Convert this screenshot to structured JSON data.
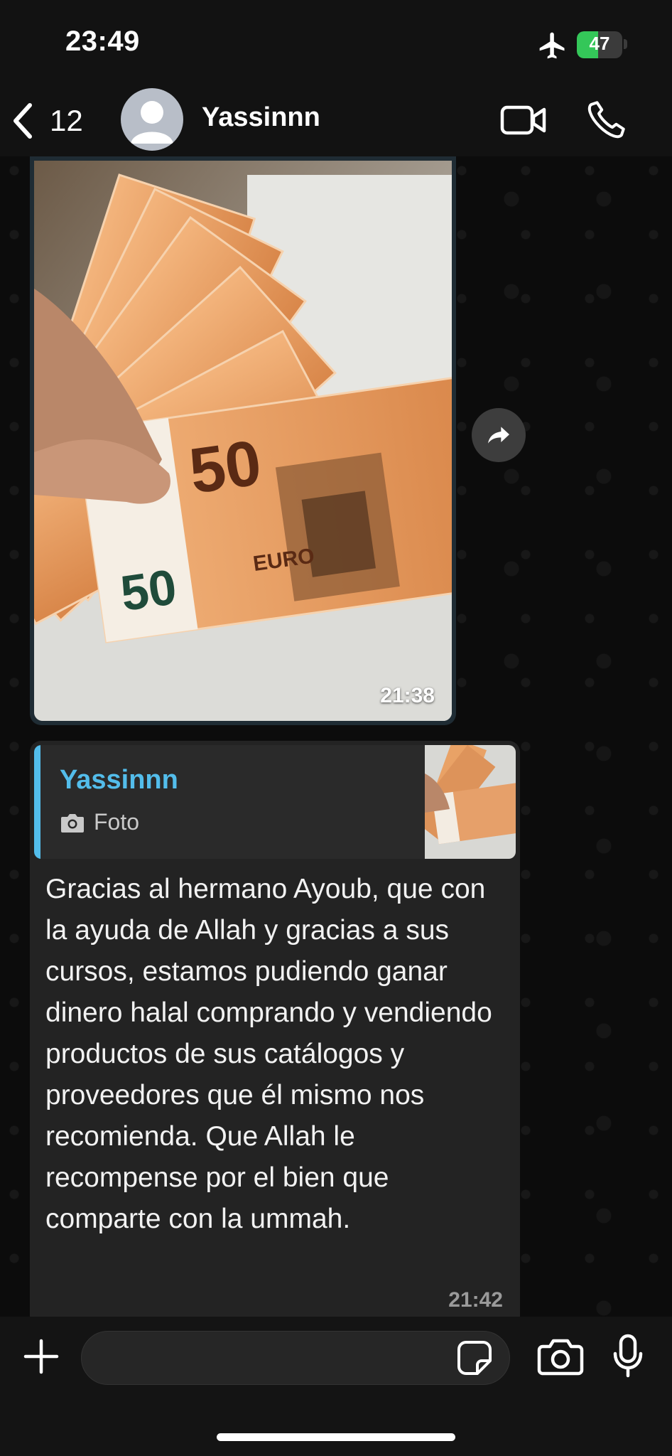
{
  "status_bar": {
    "time": "23:49",
    "battery_percent": "47",
    "battery_level": 0.47,
    "airplane_mode": true,
    "icons": [
      "airplane-icon",
      "battery-icon"
    ]
  },
  "header": {
    "back_count": "12",
    "contact_name": "Yassinnn",
    "icons": [
      "chevron-left-icon",
      "avatar-icon",
      "video-camera-icon",
      "phone-icon"
    ]
  },
  "messages": [
    {
      "type": "image",
      "time": "21:38",
      "image_description_icon": "euro-banknotes-photo"
    },
    {
      "type": "text",
      "quote": {
        "author": "Yassinnn",
        "media_label": "Foto"
      },
      "text": "Gracias al hermano Ayoub, que con la ayuda de Allah y gracias a sus cursos, estamos pudiendo ganar dinero halal comprando y vendiendo productos de sus catálogos y proveedores que él mismo nos recomienda. Que Allah le recompense por el bien que comparte con la ummah.",
      "time": "21:42"
    }
  ],
  "composer": {
    "placeholder": "",
    "icons": [
      "plus-icon",
      "sticker-icon",
      "camera-icon",
      "microphone-icon"
    ]
  },
  "colors": {
    "accent_blue": "#53bdeb",
    "battery_green": "#34c759",
    "bubble_dark": "#232323",
    "background": "#0c0c0c"
  }
}
